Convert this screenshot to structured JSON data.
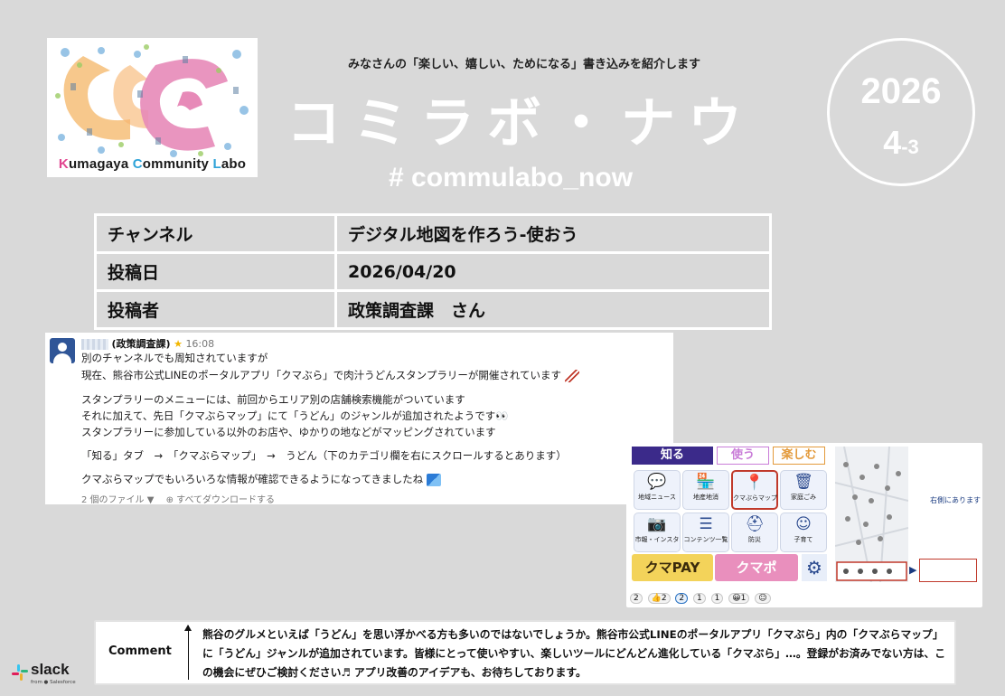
{
  "logo": {
    "text_k": "K",
    "text_1": "umagaya ",
    "text_c": "C",
    "text_2": "ommunity ",
    "text_l": "L",
    "text_3": "abo",
    "colors": {
      "pink": "#e78ab8",
      "orange": "#f6b26b",
      "blue": "#7fb6e0",
      "green": "#9ccc65"
    }
  },
  "header": {
    "tagline": "みなさんの「楽しい、嬉しい、ためになる」書き込みを紹介します",
    "title": "コミラボ・ナウ",
    "hashtag": "# commulabo_now",
    "year": "2026",
    "month": "4",
    "month_suffix": "-3"
  },
  "info": {
    "channel_label": "チャンネル",
    "channel_value": "デジタル地図を作ろう-使おう",
    "date_label": "投稿日",
    "date_value": "2026/04/20",
    "author_label": "投稿者",
    "author_value": "政策調査課　さん"
  },
  "post": {
    "name": "(政策調査課)",
    "star": "★",
    "time": "16:08",
    "lines": [
      "別のチャンネルでも周知されていますが",
      "現在、熊谷市公式LINEのポータルアプリ「クマぶら」で肉汁うどんスタンプラリーが開催されています",
      "スタンプラリーのメニューには、前回からエリア別の店舗検索機能がついています",
      "それに加えて、先日「クマぶらマップ」にて「うどん」のジャンルが追加されたようです",
      "スタンプラリーに参加している以外のお店や、ゆかりの地などがマッピングされています",
      "「知る」タブ　→　「クマぶらマップ」　→　うどん（下のカテゴリ欄を右にスクロールするとあります）",
      "クマぶらマップでもいろいろな情報が確認できるようになってきましたね"
    ],
    "files": "2 個のファイル ▼　 ⊕ すべてダウンロードする"
  },
  "app": {
    "tabs": [
      "知る",
      "使う",
      "楽しむ"
    ],
    "tiles": [
      {
        "icon": "💬",
        "label": "地域ニュース"
      },
      {
        "icon": "🏪",
        "label": "地産地消"
      },
      {
        "icon": "📍",
        "label": "クマぶらマップ"
      },
      {
        "icon": "🗑",
        "label": "家庭ごみ"
      },
      {
        "icon": "📷",
        "label": "市報・インスタ"
      },
      {
        "icon": "☰",
        "label": "コンテンツ一覧"
      },
      {
        "icon": "⛑",
        "label": "防災"
      },
      {
        "icon": "☺",
        "label": "子育て"
      }
    ],
    "kumapay": "クマPAY",
    "kumapo": "クマポ",
    "scroll_note": "右側にあります",
    "reactions": [
      "2",
      "👍2",
      "2",
      "1",
      "1",
      "😀1",
      "☺"
    ]
  },
  "comment": {
    "label": "Comment",
    "text": "熊谷のグルメといえば「うどん」を思い浮かべる方も多いのではないでしょうか。熊谷市公式LINEのポータルアプリ「クマぶら」内の「クマぶらマップ」に「うどん」ジャンルが追加されています。皆様にとって使いやすい、楽しいツールにどんどん進化している「クマぶら」…。登録がお済みでない方は、この機会にぜひご検討ください♬ アプリ改善のアイデアも、お待ちしております。"
  },
  "slack": {
    "word": "slack",
    "sub": "from ● Salesforce"
  }
}
